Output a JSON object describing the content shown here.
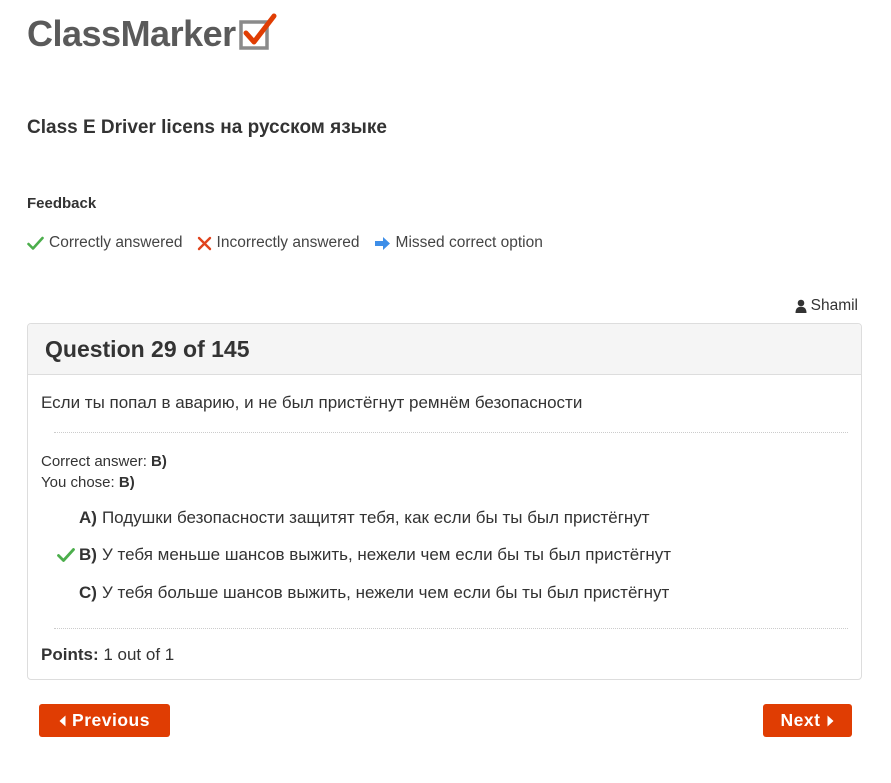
{
  "logo": {
    "text": "ClassMarker",
    "check_icon": "checkbox-icon"
  },
  "test_title": "Class E Driver licens на русском языке",
  "feedback": {
    "title": "Feedback",
    "legend": {
      "correct": "Correctly answered",
      "incorrect": "Incorrectly answered",
      "missed": "Missed correct option"
    }
  },
  "user": {
    "name": "Shamil",
    "icon": "user-icon"
  },
  "question": {
    "header": "Question 29 of 145",
    "text": "Если ты попал в аварию, и не был пристёгнут ремнём безопасности",
    "correct_answer_label": "Correct answer:",
    "correct_answer_value": "B)",
    "you_chose_label": "You chose:",
    "you_chose_value": "B)",
    "options": [
      {
        "letter": "A)",
        "text": "Подушки безопасности защитят тебя, как если бы ты был пристёгнут",
        "mark": ""
      },
      {
        "letter": "B)",
        "text": "У тебя меньше шансов выжить, нежели чем если бы ты был пристёгнут",
        "mark": "check-icon"
      },
      {
        "letter": "C)",
        "text": "У тебя больше шансов выжить, нежели чем если бы ты был пристёгнут",
        "mark": ""
      }
    ],
    "points_label": "Points:",
    "points_value": "1 out of 1"
  },
  "nav": {
    "previous_label": "Previous",
    "next_label": "Next"
  },
  "colors": {
    "accent": "#e03d03",
    "correct": "#4cae4c",
    "incorrect": "#e0431d",
    "missed": "#3d8ee8",
    "logo_text": "#5a5a5a"
  }
}
